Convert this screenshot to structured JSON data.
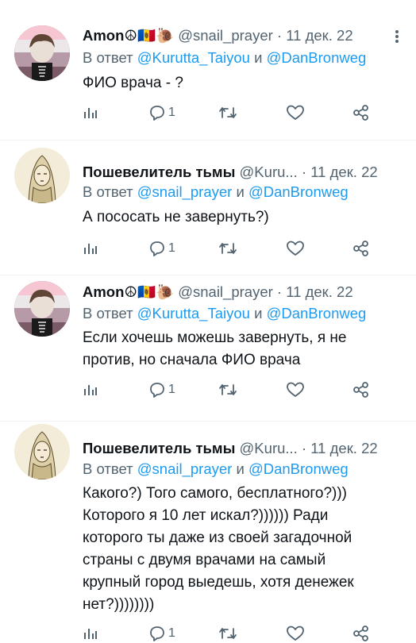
{
  "colors": {
    "text": "#0f1419",
    "secondary": "#536471",
    "link": "#1d9bf0",
    "divider": "#eff3f4"
  },
  "tweets": [
    {
      "name": "Amon☮🇲🇩🐌",
      "handle": "@snail_prayer",
      "dot": "·",
      "date": "11 дек. 22",
      "reply_prefix": "В ответ",
      "reply_mention_1": "@Kurutta_Taiyou",
      "reply_and": "и",
      "reply_mention_2": "@DanBronweg",
      "text_lines": [
        "ФИО врача - ?"
      ],
      "reply_count": "1",
      "avatar": "avatar-amon"
    },
    {
      "name": "Пошевелитель тьмы",
      "handle": "@Kuru...",
      "dot": "·",
      "date": "11 дек. 22",
      "reply_prefix": "В ответ",
      "reply_mention_1": "@snail_prayer",
      "reply_and": "и",
      "reply_mention_2": "@DanBronweg",
      "text_lines": [
        "А пососать не завернуть?)"
      ],
      "reply_count": "1",
      "avatar": "avatar-poshevelitel"
    },
    {
      "name": "Amon☮🇲🇩🐌",
      "handle": "@snail_prayer",
      "dot": "·",
      "date": "11 дек. 22",
      "reply_prefix": "В ответ",
      "reply_mention_1": "@Kurutta_Taiyou",
      "reply_and": "и",
      "reply_mention_2": "@DanBronweg",
      "text_lines": [
        "Если хочешь можешь завернуть, я не",
        "против, но сначала ФИО врача"
      ],
      "reply_count": "1",
      "avatar": "avatar-amon"
    },
    {
      "name": "Пошевелитель тьмы",
      "handle": "@Kuru...",
      "dot": "·",
      "date": "11 дек. 22",
      "reply_prefix": "В ответ",
      "reply_mention_1": "@snail_prayer",
      "reply_and": "и",
      "reply_mention_2": "@DanBronweg",
      "text_lines": [
        "Какого?) Того самого, бесплатного?)))",
        "Которого я 10 лет искал?)))))) Ради",
        "которого ты даже из своей загадочной",
        "страны с двумя врачами на самый",
        "крупный город выедешь, хотя денежек",
        "нет?))))))))"
      ],
      "reply_count": "1",
      "avatar": "avatar-poshevelitel"
    }
  ],
  "icons": {
    "more": "more-dots-icon",
    "analytics": "analytics-icon",
    "reply": "reply-icon",
    "retweet": "retweet-icon",
    "like": "heart-icon",
    "share": "share-icon"
  }
}
